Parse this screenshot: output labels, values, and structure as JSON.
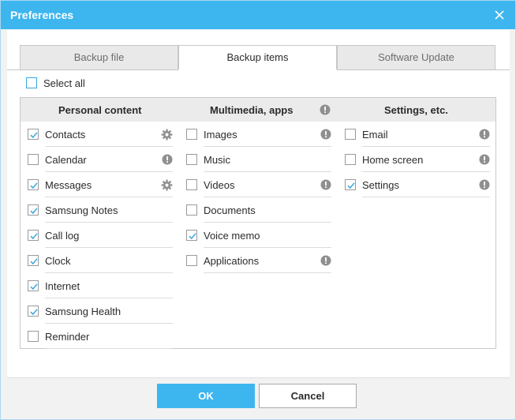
{
  "window": {
    "title": "Preferences"
  },
  "tabs": [
    {
      "label": "Backup file",
      "active": false
    },
    {
      "label": "Backup items",
      "active": true
    },
    {
      "label": "Software Update",
      "active": false
    }
  ],
  "select_all": {
    "label": "Select all",
    "checked": false
  },
  "columns": [
    {
      "title": "Personal content",
      "header_icon": "",
      "items": [
        {
          "label": "Contacts",
          "checked": true,
          "icon": "gear-icon"
        },
        {
          "label": "Calendar",
          "checked": false,
          "icon": "info-icon"
        },
        {
          "label": "Messages",
          "checked": true,
          "icon": "gear-icon"
        },
        {
          "label": "Samsung Notes",
          "checked": true,
          "icon": ""
        },
        {
          "label": "Call log",
          "checked": true,
          "icon": ""
        },
        {
          "label": "Clock",
          "checked": true,
          "icon": ""
        },
        {
          "label": "Internet",
          "checked": true,
          "icon": ""
        },
        {
          "label": "Samsung Health",
          "checked": true,
          "icon": ""
        },
        {
          "label": "Reminder",
          "checked": false,
          "icon": ""
        }
      ]
    },
    {
      "title": "Multimedia, apps",
      "header_icon": "info-icon",
      "items": [
        {
          "label": "Images",
          "checked": false,
          "icon": "info-icon"
        },
        {
          "label": "Music",
          "checked": false,
          "icon": ""
        },
        {
          "label": "Videos",
          "checked": false,
          "icon": "info-icon"
        },
        {
          "label": "Documents",
          "checked": false,
          "icon": ""
        },
        {
          "label": "Voice memo",
          "checked": true,
          "icon": ""
        },
        {
          "label": "Applications",
          "checked": false,
          "icon": "info-icon"
        }
      ]
    },
    {
      "title": "Settings, etc.",
      "header_icon": "",
      "items": [
        {
          "label": "Email",
          "checked": false,
          "icon": "info-icon"
        },
        {
          "label": "Home screen",
          "checked": false,
          "icon": "info-icon"
        },
        {
          "label": "Settings",
          "checked": true,
          "icon": "info-icon"
        }
      ]
    }
  ],
  "buttons": {
    "ok": "OK",
    "cancel": "Cancel"
  },
  "colors": {
    "accent": "#3db6ef",
    "check": "#3aa6de",
    "icon": "#8f8f8f"
  }
}
